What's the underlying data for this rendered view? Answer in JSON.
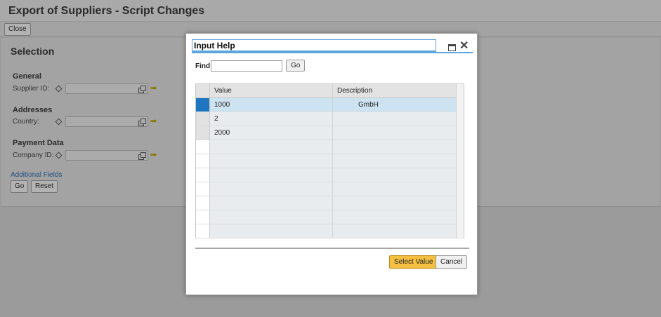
{
  "page": {
    "title": "Export of Suppliers - Script Changes",
    "close_label": "Close",
    "section_title": "Selection",
    "groups": [
      {
        "title": "General",
        "field_label": "Supplier ID:"
      },
      {
        "title": "Addresses",
        "field_label": "Country:"
      },
      {
        "title": "Payment Data",
        "field_label": "Company ID:"
      }
    ],
    "additional_fields_label": "Additional Fields",
    "go_label": "Go",
    "reset_label": "Reset"
  },
  "dialog": {
    "title": "Input Help",
    "find_label": "Find",
    "find_value": "",
    "find_go_label": "Go",
    "table": {
      "columns": [
        "Value",
        "Description"
      ],
      "rows": [
        {
          "value": "1000",
          "description": "GmbH",
          "selected": true
        },
        {
          "value": "2",
          "description": ""
        },
        {
          "value": "2000",
          "description": ""
        }
      ],
      "empty_rows": 7
    },
    "select_label": "Select Value",
    "cancel_label": "Cancel"
  },
  "colors": {
    "accent": "#5ea4dd",
    "selected_row": "#cde3f1",
    "selector": "#1e75c0",
    "primary_button": "#f5c041"
  }
}
